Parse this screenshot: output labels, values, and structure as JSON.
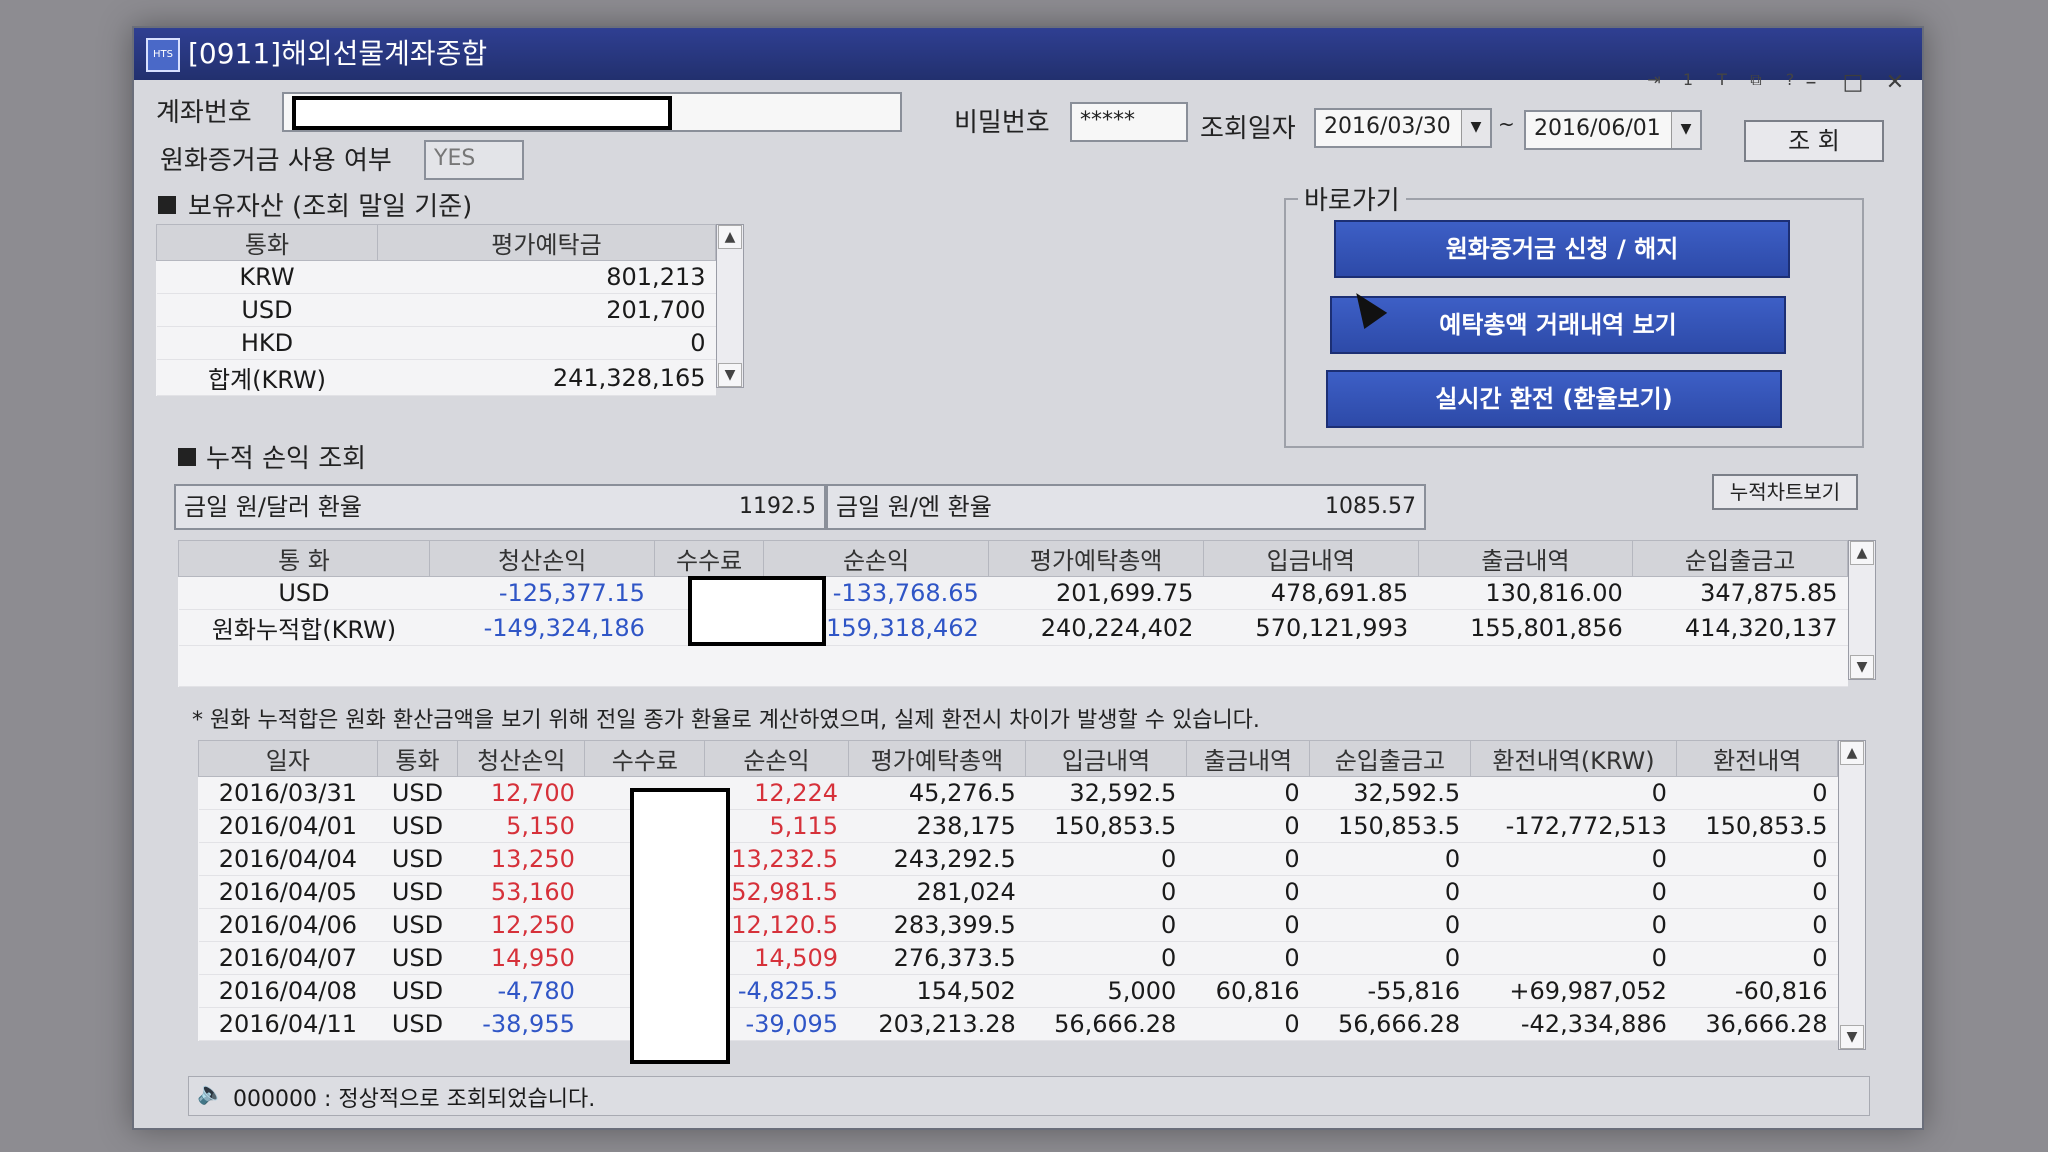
{
  "window": {
    "title": "[0911]해외선물계좌종합",
    "app_icon": "HTS"
  },
  "header": {
    "account_label": "계좌번호",
    "password_label": "비밀번호",
    "password_value": "*****",
    "query_date_label": "조회일자",
    "date_from": "2016/03/30",
    "date_separator": "~",
    "date_to": "2016/06/01",
    "query_button": "조 회",
    "krw_margin_label": "원화증거금 사용 여부",
    "krw_margin_value": "YES"
  },
  "holdings": {
    "section_title": "보유자산 (조회 말일 기준)",
    "columns": [
      "통화",
      "평가예탁금"
    ],
    "rows": [
      {
        "currency": "KRW",
        "value": "801,213"
      },
      {
        "currency": "USD",
        "value": "201,700"
      },
      {
        "currency": "HKD",
        "value": "0"
      }
    ],
    "total_label": "합계(KRW)",
    "total_value": "241,328,165"
  },
  "shortcuts": {
    "group_label": "바로가기",
    "buttons": [
      "원화증거금 신청 / 해지",
      "예탁총액 거래내역 보기",
      "실시간 환전 (환율보기)"
    ]
  },
  "cumulative": {
    "section_title": "누적 손익 조회",
    "chart_button": "누적차트보기",
    "usd_rate_label": "금일 원/달러 환율",
    "usd_rate_value": "1192.5",
    "jpy_rate_label": "금일 원/엔 환율",
    "jpy_rate_value": "1085.57",
    "columns": [
      "통 화",
      "청산손익",
      "수수료",
      "순손익",
      "평가예탁총액",
      "입금내역",
      "출금내역",
      "순입출금고"
    ],
    "rows": [
      {
        "currency": "USD",
        "pnl": "-125,377.15",
        "net": "-133,768.65",
        "deposit_total": "201,699.75",
        "in": "478,691.85",
        "out": "130,816.00",
        "net_io": "347,875.85"
      },
      {
        "currency": "원화누적합(KRW)",
        "pnl": "-149,324,186",
        "net": "-159,318,462",
        "deposit_total": "240,224,402",
        "in": "570,121,993",
        "out": "155,801,856",
        "net_io": "414,320,137"
      }
    ],
    "note": "* 원화 누적합은 원화 환산금액을 보기 위해 전일 종가 환율로 계산하였으며, 실제 환전시 차이가 발생할 수 있습니다."
  },
  "daily": {
    "columns": [
      "일자",
      "통화",
      "청산손익",
      "수수료",
      "순손익",
      "평가예탁총액",
      "입금내역",
      "출금내역",
      "순입출금고",
      "환전내역(KRW)",
      "환전내역"
    ],
    "rows": [
      {
        "date": "2016/03/31",
        "cur": "USD",
        "pnl": "12,700",
        "net": "12,224",
        "total": "45,276.5",
        "in": "32,592.5",
        "out": "0",
        "netio": "32,592.5",
        "fxkrw": "0",
        "fx": "0",
        "sign": "pos"
      },
      {
        "date": "2016/04/01",
        "cur": "USD",
        "pnl": "5,150",
        "net": "5,115",
        "total": "238,175",
        "in": "150,853.5",
        "out": "0",
        "netio": "150,853.5",
        "fxkrw": "-172,772,513",
        "fx": "150,853.5",
        "sign": "pos"
      },
      {
        "date": "2016/04/04",
        "cur": "USD",
        "pnl": "13,250",
        "net": "13,232.5",
        "total": "243,292.5",
        "in": "0",
        "out": "0",
        "netio": "0",
        "fxkrw": "0",
        "fx": "0",
        "sign": "pos"
      },
      {
        "date": "2016/04/05",
        "cur": "USD",
        "pnl": "53,160",
        "net": "52,981.5",
        "total": "281,024",
        "in": "0",
        "out": "0",
        "netio": "0",
        "fxkrw": "0",
        "fx": "0",
        "sign": "pos"
      },
      {
        "date": "2016/04/06",
        "cur": "USD",
        "pnl": "12,250",
        "net": "12,120.5",
        "total": "283,399.5",
        "in": "0",
        "out": "0",
        "netio": "0",
        "fxkrw": "0",
        "fx": "0",
        "sign": "pos"
      },
      {
        "date": "2016/04/07",
        "cur": "USD",
        "pnl": "14,950",
        "net": "14,509",
        "total": "276,373.5",
        "in": "0",
        "out": "0",
        "netio": "0",
        "fxkrw": "0",
        "fx": "0",
        "sign": "pos"
      },
      {
        "date": "2016/04/08",
        "cur": "USD",
        "pnl": "-4,780",
        "net": "-4,825.5",
        "total": "154,502",
        "in": "5,000",
        "out": "60,816",
        "netio": "-55,816",
        "fxkrw": "+69,987,052",
        "fx": "-60,816",
        "sign": "neg"
      },
      {
        "date": "2016/04/11",
        "cur": "USD",
        "pnl": "-38,955",
        "net": "-39,095",
        "total": "203,213.28",
        "in": "56,666.28",
        "out": "0",
        "netio": "56,666.28",
        "fxkrw": "-42,334,886",
        "fx": "36,666.28",
        "sign": "neg"
      }
    ]
  },
  "status": {
    "text": "000000 : 정상적으로 조회되었습니다."
  }
}
